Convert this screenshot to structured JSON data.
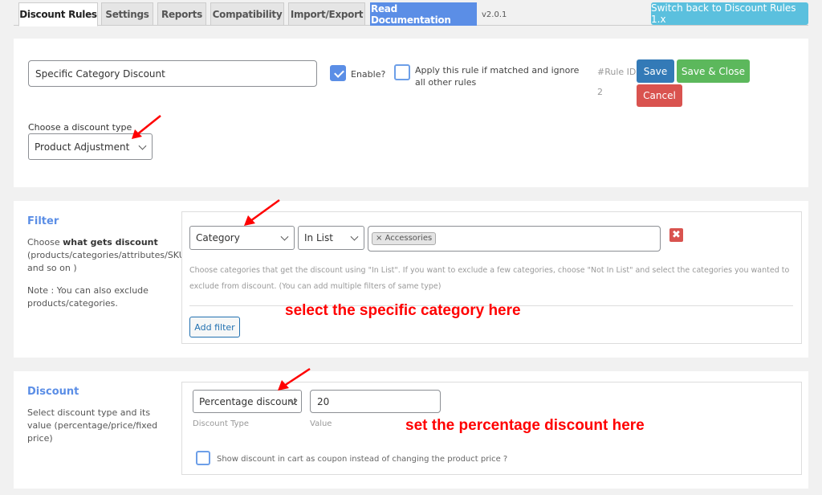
{
  "tabs": [
    {
      "label": "Discount Rules",
      "active": true
    },
    {
      "label": "Settings"
    },
    {
      "label": "Reports"
    },
    {
      "label": "Compatibility"
    },
    {
      "label": "Import/Export"
    },
    {
      "label": "Read Documentation"
    }
  ],
  "version": "v2.0.1",
  "switch_button": "Switch back to Discount Rules 1.x",
  "rule": {
    "name_value": "Specific Category Discount",
    "enable_label": "Enable?",
    "enable_checked": true,
    "exclusive_label": "Apply this rule if matched and ignore all other rules",
    "exclusive_checked": false,
    "rule_id_label": "#Rule ID:",
    "rule_id_value": "2",
    "save": "Save",
    "save_close": "Save & Close",
    "cancel": "Cancel",
    "discount_type_label": "Choose a discount type",
    "discount_type_value": "Product Adjustment"
  },
  "filter": {
    "title": "Filter",
    "desc_prefix": "Choose ",
    "desc_bold": "what gets discount",
    "desc_rest": "(products/categories/attributes/SKU and so on )",
    "note": "Note : You can also exclude products/categories.",
    "type_value": "Category",
    "operator_value": "In List",
    "selected_tags": [
      "Accessories"
    ],
    "tag_remove_glyph": "×",
    "remove_glyph": "✖",
    "hint": "Choose categories that get the discount using \"In List\". If you want to exclude a few categories, choose \"Not In List\" and select the categories you wanted to exclude from discount. (You can add multiple filters of same type)",
    "add_filter": "Add filter",
    "annotation": "select the specific category here"
  },
  "discount": {
    "title": "Discount",
    "desc": "Select discount type and its value (percentage/price/fixed price)",
    "type_value": "Percentage discount",
    "type_label": "Discount Type",
    "value": "20",
    "value_label": "Value",
    "annotation": "set the percentage discount here",
    "coupon_label": "Show discount in cart as coupon instead of changing the product price ?",
    "coupon_checked": false
  },
  "colors": {
    "accent": "#5b8ee6",
    "save": "#337ab7",
    "save_close": "#5cb85c",
    "cancel": "#d9534f",
    "annotation": "#ff0000"
  }
}
